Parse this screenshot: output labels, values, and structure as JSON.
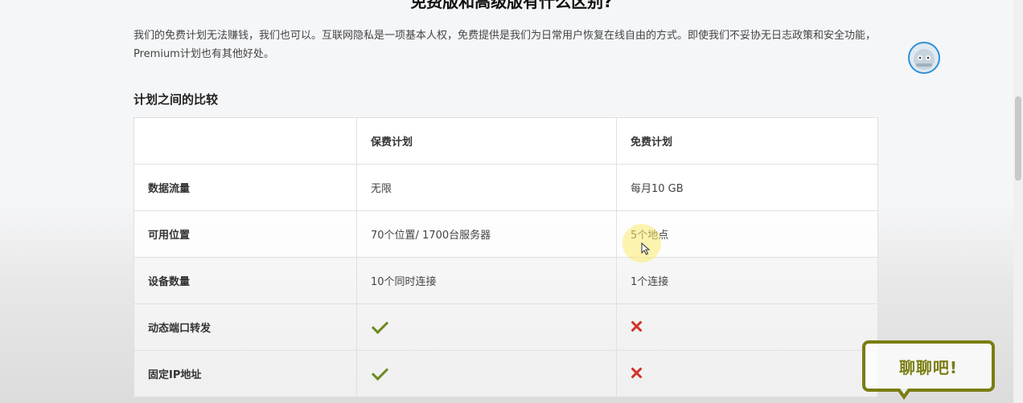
{
  "page": {
    "heading": "免费版和高级版有什么区别?",
    "intro": "我们的免费计划无法赚钱，我们也可以。互联网隐私是一项基本人权，免费提供是我们为日常用户恢复在线自由的方式。即使我们不妥协无日志政策和安全功能，Premium计划也有其他好处。",
    "section_title": "计划之间的比较"
  },
  "table": {
    "headers": [
      "",
      "保费计划",
      "免费计划"
    ],
    "rows": [
      {
        "feature": "数据流量",
        "premium": "无限",
        "free": "每月10 GB"
      },
      {
        "feature": "可用位置",
        "premium": "70个位置/ 1700台服务器",
        "free": "5个地点"
      },
      {
        "feature": "设备数量",
        "premium": "10个同时连接",
        "free": "1个连接"
      },
      {
        "feature": "动态端口转发",
        "premium_icon": "check-icon",
        "free_icon": "cross-icon"
      },
      {
        "feature": "固定IP地址",
        "premium_icon": "check-icon",
        "free_icon": "cross-icon"
      }
    ]
  },
  "chat": {
    "label": "聊聊吧!"
  },
  "colors": {
    "check": "#6b8a1f",
    "cross": "#d0342c",
    "chat_border": "#7a7d12",
    "avatar_ring": "#2f8fd8"
  }
}
